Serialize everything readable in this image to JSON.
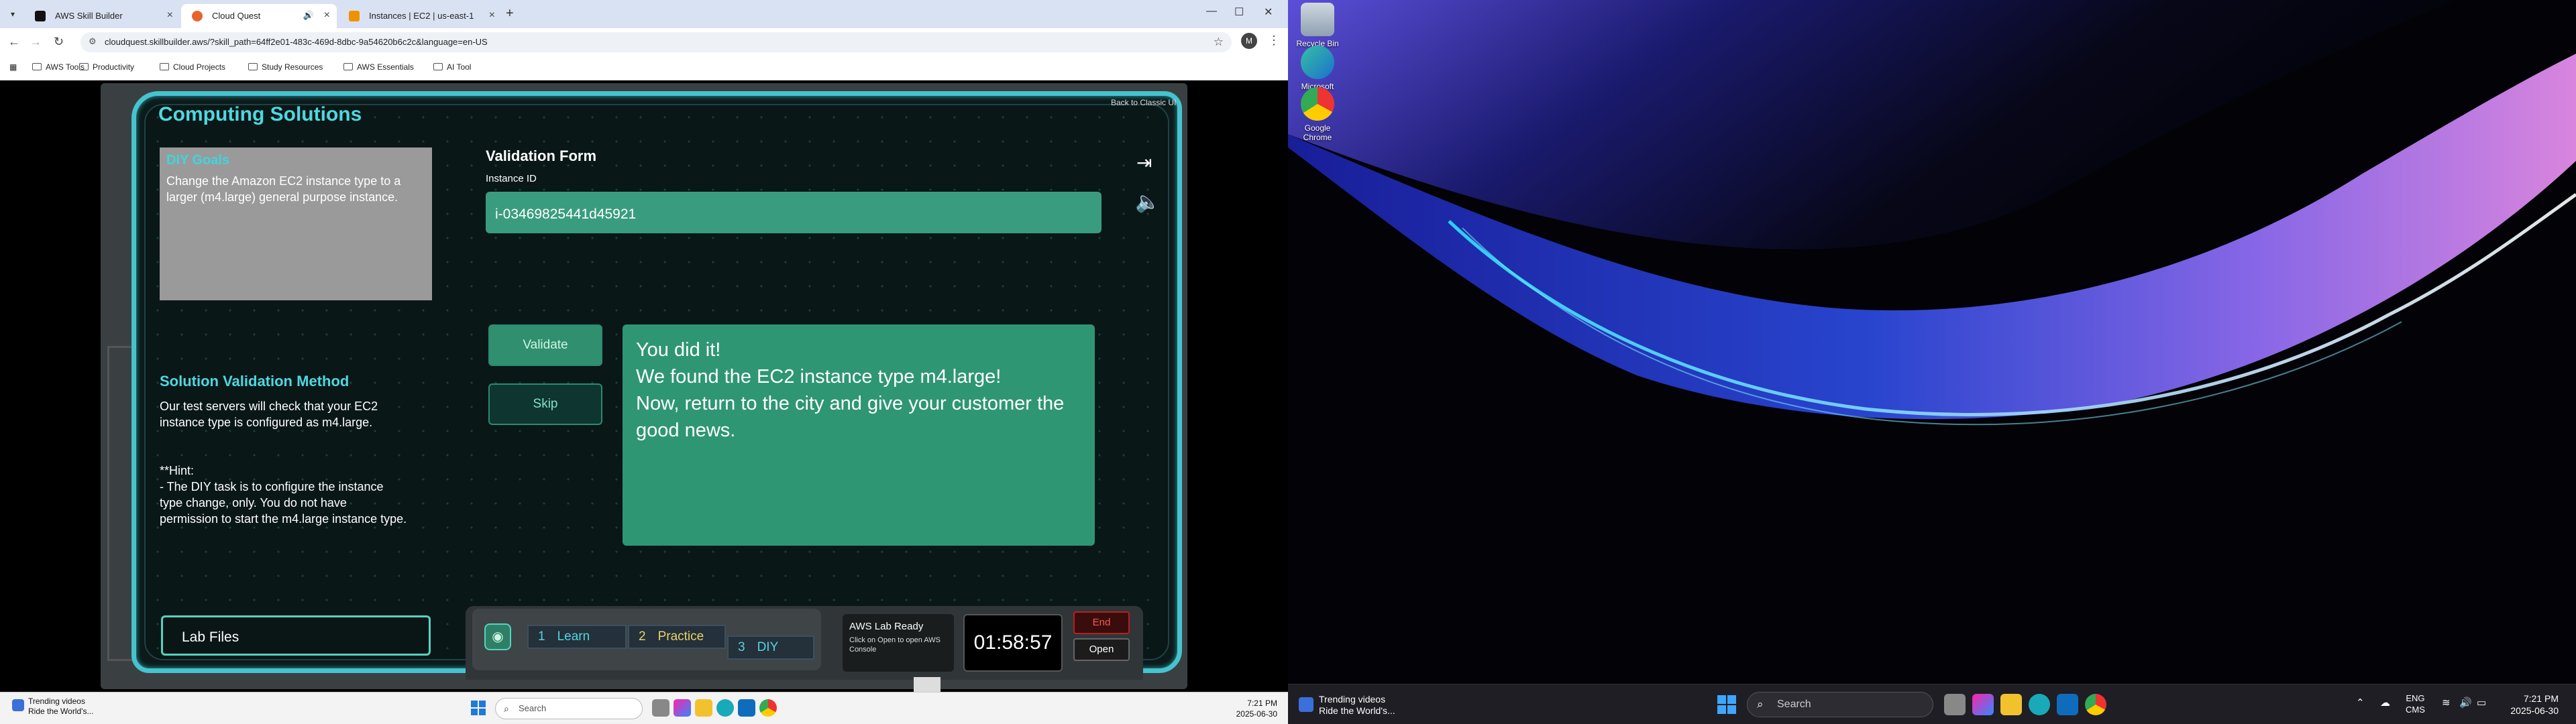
{
  "browser": {
    "tabs": [
      {
        "title": "AWS Skill Builder",
        "fav_color": "#111111"
      },
      {
        "title": "Cloud Quest",
        "fav_color": "#e8622d"
      },
      {
        "title": "Instances | EC2 | us-east-1",
        "fav_color": "#f29100"
      }
    ],
    "url": "cloudquest.skillbuilder.aws/?skill_path=64ff2e01-483c-469d-8dbc-9a54620b6c2c&language=en-US",
    "profile_initial": "M",
    "bookmarks": [
      "AWS Tools",
      "Productivity",
      "Cloud Projects",
      "Study Resources",
      "AWS Essentials",
      "AI Tool"
    ]
  },
  "game": {
    "title": "Computing Solutions",
    "back_classic": "Back to Classic UI",
    "diy_goals": {
      "heading": "DIY Goals",
      "text": "Change the Amazon EC2 instance type to a larger (m4.large) general purpose instance."
    },
    "validation_form": {
      "title": "Validation Form",
      "instance_label": "Instance ID",
      "instance_value": "i-03469825441d45921"
    },
    "solution_method": {
      "heading": "Solution Validation Method",
      "text": "Our test servers will check that your EC2 instance type is configured as m4.large.",
      "hint": "**Hint:\n- The DIY task is to configure the instance type change, only. You do not have permission to start the m4.large instance type."
    },
    "buttons": {
      "validate": "Validate",
      "skip": "Skip"
    },
    "success_message": "You did it!\nWe found the EC2 instance type m4.large!\nNow, return to the city and give your customer the good news.",
    "lab_files": "Lab Files",
    "steps": [
      {
        "num": "1",
        "label": "Learn"
      },
      {
        "num": "2",
        "label": "Practice"
      },
      {
        "num": "3",
        "label": "DIY"
      }
    ],
    "lab_status": {
      "title": "AWS Lab Ready",
      "sub": "Click on Open to open AWS Console"
    },
    "timer": "01:58:57",
    "end_label": "End",
    "open_label": "Open"
  },
  "taskbar_left": {
    "widget_title": "Trending videos",
    "widget_sub": "Ride the World's...",
    "search_placeholder": "Search",
    "time": "7:21 PM",
    "date": "2025-06-30"
  },
  "desktop": {
    "icons": [
      {
        "label": "Recycle Bin"
      },
      {
        "label": "Microsoft Edge"
      },
      {
        "label": "Google Chrome"
      }
    ]
  },
  "taskbar_right": {
    "widget_title": "Trending videos",
    "widget_sub": "Ride the World's...",
    "search_placeholder": "Search",
    "lang": "ENG",
    "lang_sub": "CMS",
    "time": "7:21 PM",
    "date": "2025-06-30"
  }
}
